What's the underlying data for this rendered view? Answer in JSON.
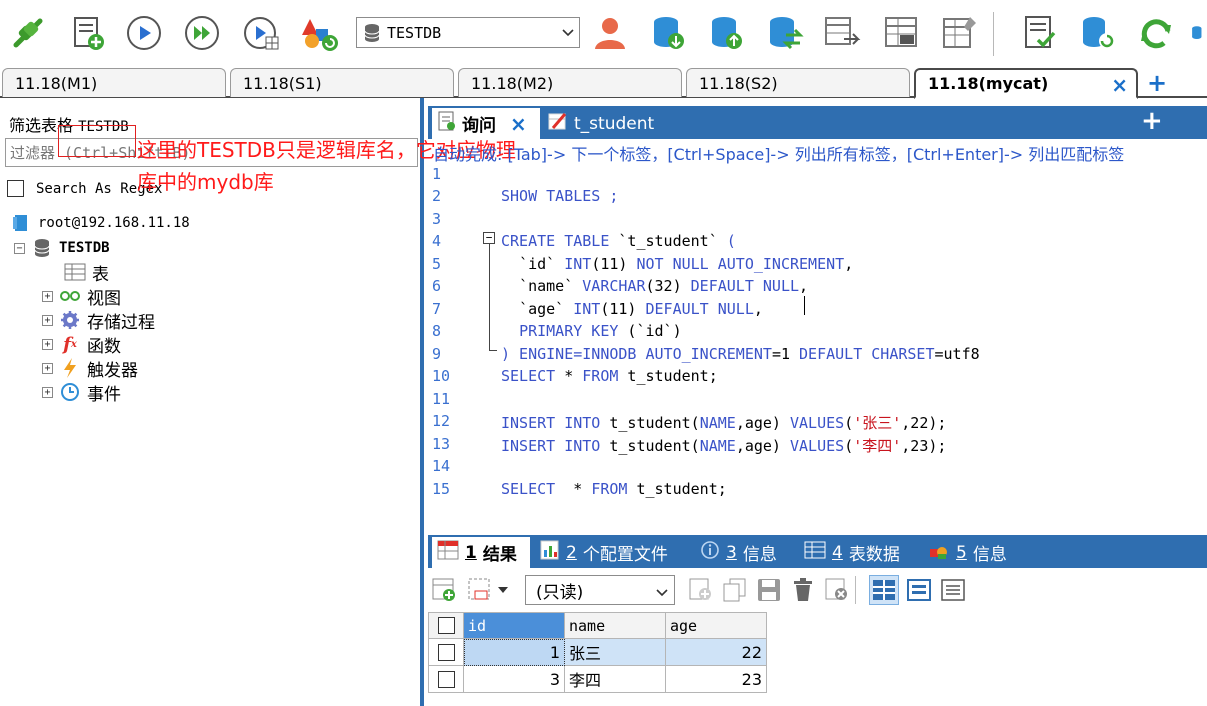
{
  "toolbar": {
    "icons": [
      "connect-icon",
      "new-query-icon",
      "execute-icon",
      "execute-all-icon",
      "execute-selected-icon",
      "shapes-refresh-icon"
    ],
    "database_select": "TESTDB",
    "right_icons": [
      "user-icon",
      "backup-db-icon",
      "restore-db-icon",
      "sync-db-icon",
      "schema-sync-icon",
      "data-sync-icon",
      "table-tool-icon",
      "report-icon",
      "db-refresh-icon",
      "refresh-icon"
    ]
  },
  "connection_tabs": [
    {
      "label": "11.18(M1)"
    },
    {
      "label": "11.18(S1)"
    },
    {
      "label": "11.18(M2)"
    },
    {
      "label": "11.18(S2)"
    },
    {
      "label": "11.18(mycat)",
      "active": true
    }
  ],
  "left_panel": {
    "filter_title": "筛选表格",
    "filter_db": "TESTDB",
    "filter_placeholder": "过滤器 (Ctrl+Shift+B)",
    "regex_label": "Search As Regex",
    "connection": "root@192.168.11.18",
    "database": "TESTDB",
    "tree": [
      "表",
      "视图",
      "存储过程",
      "函数",
      "触发器",
      "事件"
    ]
  },
  "annotation": "这里的TESTDB只是逻辑库名，它对应物理库中的mydb库",
  "editor": {
    "tabs": [
      {
        "label": "询问",
        "active": true
      },
      {
        "label": "t_student"
      }
    ],
    "autocomplete": "自动完成: [Tab]-> 下一个标签，[Ctrl+Space]-> 列出所有标签，[Ctrl+Enter]-> 列出匹配标签",
    "line_numbers": [
      "1",
      "2",
      "3",
      "4",
      "5",
      "6",
      "7",
      "8",
      "9",
      "10",
      "11",
      "12",
      "13",
      "14",
      "15"
    ]
  },
  "results": {
    "tabs": [
      {
        "num": "1",
        "label": "结果"
      },
      {
        "num": "2",
        "label": "个配置文件"
      },
      {
        "num": "3",
        "label": "信息"
      },
      {
        "num": "4",
        "label": "表数据"
      },
      {
        "num": "5",
        "label": "信息"
      }
    ],
    "readonly_label": "(只读)",
    "columns": [
      "id",
      "name",
      "age"
    ],
    "rows": [
      {
        "id": "1",
        "name": "张三",
        "age": "22"
      },
      {
        "id": "3",
        "name": "李四",
        "age": "23"
      }
    ]
  }
}
